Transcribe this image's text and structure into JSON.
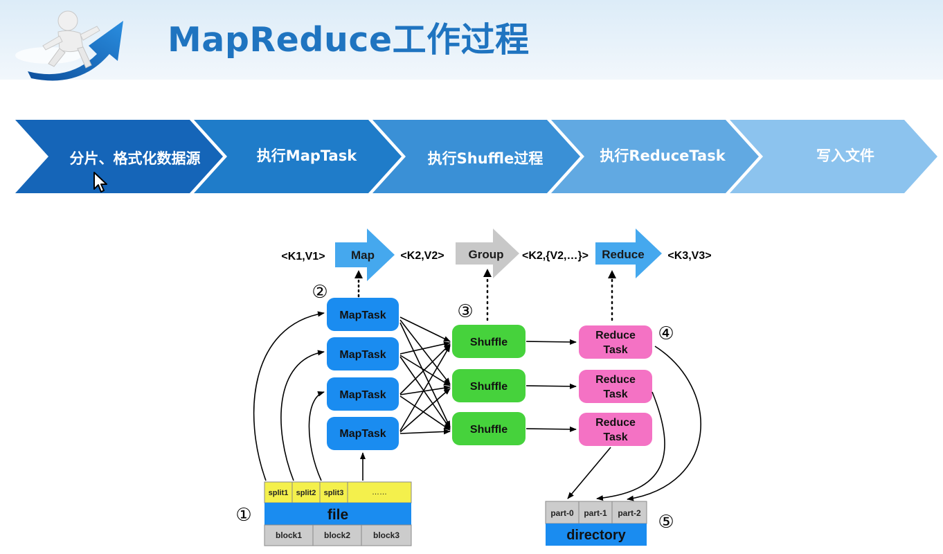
{
  "header": {
    "title": "MapReduce工作过程"
  },
  "steps": [
    {
      "label": "分片、格式化数据源"
    },
    {
      "label": "执行MapTask"
    },
    {
      "label": "执行Shuffle过程"
    },
    {
      "label": "执行ReduceTask"
    },
    {
      "label": "写入文件"
    }
  ],
  "flow": {
    "k1v1": "<K1,V1>",
    "map": "Map",
    "k2v2": "<K2,V2>",
    "group": "Group",
    "k2v2list": "<K2,{V2,…}>",
    "reduce": "Reduce",
    "k3v3": "<K3,V3>"
  },
  "markers": [
    "①",
    "②",
    "③",
    "④",
    "⑤"
  ],
  "maptask": "MapTask",
  "shuffle": "Shuffle",
  "reduce_task": {
    "line1": "Reduce",
    "line2": "Task"
  },
  "file": {
    "splits": [
      "split1",
      "split2",
      "split3",
      "……"
    ],
    "label": "file",
    "blocks": [
      "block1",
      "block2",
      "block3"
    ]
  },
  "directory": {
    "parts": [
      "part-0",
      "part-1",
      "part-2"
    ],
    "label": "directory"
  },
  "colors": {
    "title": "#1f74c0",
    "maptask": "#1a8cf0",
    "shuffle": "#46d23c",
    "reduce": "#f472c4",
    "split": "#f4f04c",
    "block": "#cccccc",
    "arrow_blue": "#45a8ee",
    "arrow_gray": "#c8c8c8"
  }
}
